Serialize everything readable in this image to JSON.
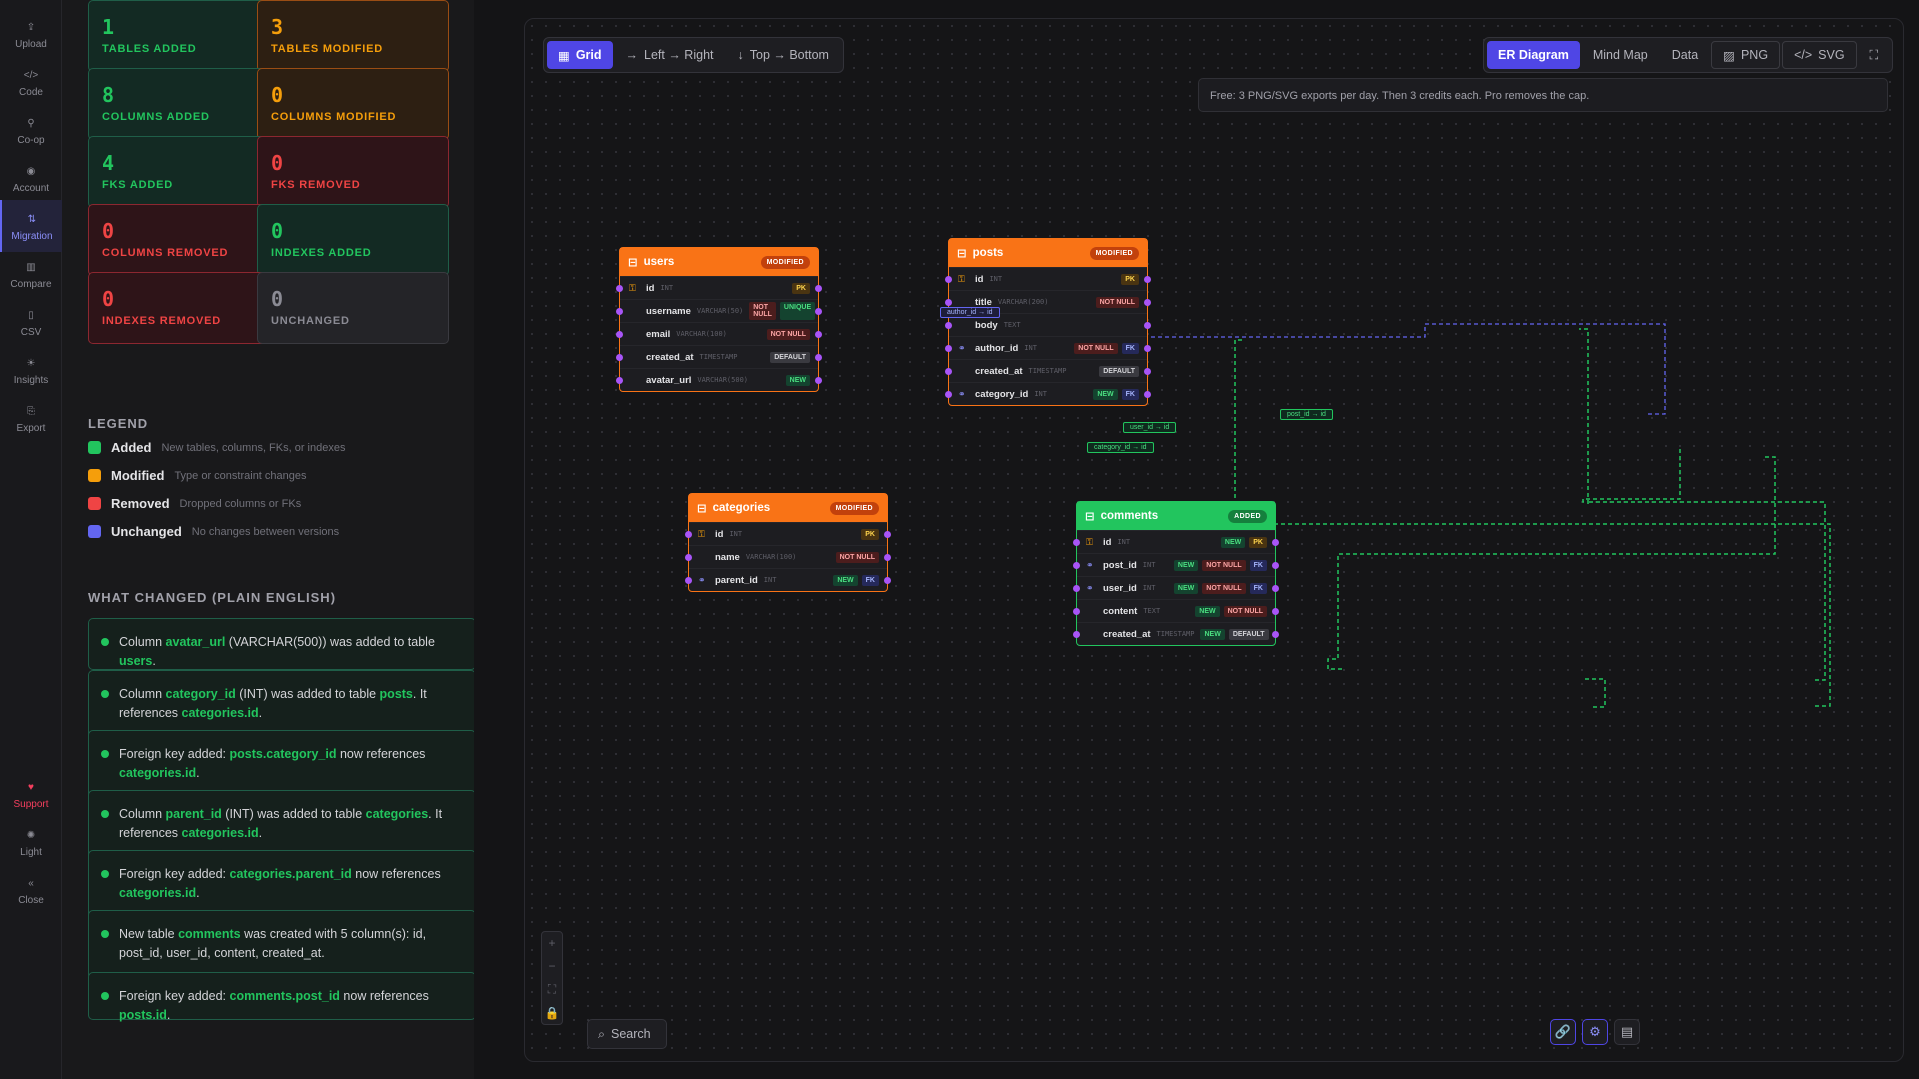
{
  "nav": [
    {
      "label": "Upload",
      "icon": "upload-icon"
    },
    {
      "label": "Code",
      "icon": "code-icon"
    },
    {
      "label": "Co-op",
      "icon": "link-icon"
    },
    {
      "label": "Account",
      "icon": "account-icon"
    },
    {
      "label": "Migration",
      "icon": "migration-icon"
    },
    {
      "label": "Compare",
      "icon": "chart-icon"
    },
    {
      "label": "CSV",
      "icon": "file-icon"
    },
    {
      "label": "Insights",
      "icon": "bulb-icon"
    },
    {
      "label": "Export",
      "icon": "export-icon"
    },
    {
      "label": "Support",
      "icon": "heart-icon"
    },
    {
      "label": "Light",
      "icon": "sun-icon"
    },
    {
      "label": "Close",
      "icon": "close-icon"
    }
  ],
  "stats": [
    {
      "value": "1",
      "label": "TABLES ADDED",
      "tone": "green"
    },
    {
      "value": "3",
      "label": "TABLES MODIFIED",
      "tone": "orange"
    },
    {
      "value": "8",
      "label": "COLUMNS ADDED",
      "tone": "green"
    },
    {
      "value": "0",
      "label": "COLUMNS MODIFIED",
      "tone": "orange"
    },
    {
      "value": "4",
      "label": "FKS ADDED",
      "tone": "green"
    },
    {
      "value": "0",
      "label": "FKS REMOVED",
      "tone": "red"
    },
    {
      "value": "0",
      "label": "COLUMNS REMOVED",
      "tone": "red"
    },
    {
      "value": "0",
      "label": "INDEXES ADDED",
      "tone": "green"
    },
    {
      "value": "0",
      "label": "INDEXES REMOVED",
      "tone": "red"
    },
    {
      "value": "0",
      "label": "UNCHANGED",
      "tone": "gray"
    }
  ],
  "legend": {
    "title": "LEGEND",
    "items": [
      {
        "name": "Added",
        "desc": "New tables, columns, FKs, or indexes",
        "color": "#22c55e"
      },
      {
        "name": "Modified",
        "desc": "Type or constraint changes",
        "color": "#f59e0b"
      },
      {
        "name": "Removed",
        "desc": "Dropped columns or FKs",
        "color": "#ef4444"
      },
      {
        "name": "Unchanged",
        "desc": "No changes between versions",
        "color": "#6366f1"
      }
    ]
  },
  "changes": {
    "title": "WHAT CHANGED (PLAIN ENGLISH)",
    "items": [
      {
        "a": "Column ",
        "b": "avatar_url",
        "c": " (VARCHAR(500)) was added to table ",
        "d": "users",
        "e": "."
      },
      {
        "a": "Column ",
        "b": "category_id",
        "c": " (INT) was added to table ",
        "d": "posts",
        "e": ". It references ",
        "f": "categories.id",
        "g": "."
      },
      {
        "a": "Foreign key added: ",
        "b": "posts.category_id",
        "c": " now references ",
        "d": "categories.id",
        "e": "."
      },
      {
        "a": "Column ",
        "b": "parent_id",
        "c": " (INT) was added to table ",
        "d": "categories",
        "e": ". It references ",
        "f": "categories.id",
        "g": "."
      },
      {
        "a": "Foreign key added: ",
        "b": "categories.parent_id",
        "c": " now references ",
        "d": "categories.id",
        "e": "."
      },
      {
        "a": "New table ",
        "b": "comments",
        "c": " was created with 5 column(s): id, post_id, user_id, content, created_at.",
        "d": "",
        "e": ""
      },
      {
        "a": "Foreign key added: ",
        "b": "comments.post_id",
        "c": " now references ",
        "d": "posts.id",
        "e": "."
      }
    ]
  },
  "toolbar": {
    "layout": [
      {
        "label": "Grid",
        "icon": "grid-icon"
      },
      {
        "label": "Left → Right",
        "icon": "arrow-right-icon"
      },
      {
        "label": "Top → Bottom",
        "icon": "arrow-down-icon"
      }
    ],
    "views": [
      "ER Diagram",
      "Mind Map",
      "Data"
    ],
    "exports": [
      {
        "label": "PNG",
        "icon": "image-icon"
      },
      {
        "label": "SVG",
        "icon": "code-icon"
      }
    ]
  },
  "notice": "Free: 3 PNG/SVG exports per day. Then 3 credits each. Pro removes the cap.",
  "search_label": "Search",
  "tables": {
    "users": {
      "name": "users",
      "badge": "MODIFIED",
      "rows": [
        {
          "icon": "key",
          "name": "id",
          "type": "INT",
          "tags": [
            [
              "PK",
              "pk"
            ]
          ]
        },
        {
          "icon": "",
          "name": "username",
          "type": "VARCHAR(50)",
          "tags": [
            [
              "NOT NULL",
              "nn"
            ],
            [
              "UNIQUE",
              "uq"
            ]
          ]
        },
        {
          "icon": "",
          "name": "email",
          "type": "VARCHAR(100)",
          "tags": [
            [
              "NOT NULL",
              "nn"
            ]
          ]
        },
        {
          "icon": "",
          "name": "created_at",
          "type": "TIMESTAMP",
          "tags": [
            [
              "DEFAULT",
              "def"
            ]
          ]
        },
        {
          "icon": "",
          "name": "avatar_url",
          "type": "VARCHAR(500)",
          "tags": [
            [
              "NEW",
              "new"
            ]
          ]
        }
      ]
    },
    "posts": {
      "name": "posts",
      "badge": "MODIFIED",
      "rows": [
        {
          "icon": "key",
          "name": "id",
          "type": "INT",
          "tags": [
            [
              "PK",
              "pk"
            ]
          ]
        },
        {
          "icon": "",
          "name": "title",
          "type": "VARCHAR(200)",
          "tags": [
            [
              "NOT NULL",
              "nn"
            ]
          ]
        },
        {
          "icon": "",
          "name": "body",
          "type": "TEXT",
          "tags": []
        },
        {
          "icon": "link",
          "name": "author_id",
          "type": "INT",
          "tags": [
            [
              "NOT NULL",
              "nn"
            ],
            [
              "FK",
              "fk"
            ]
          ]
        },
        {
          "icon": "",
          "name": "created_at",
          "type": "TIMESTAMP",
          "tags": [
            [
              "DEFAULT",
              "def"
            ]
          ]
        },
        {
          "icon": "link",
          "name": "category_id",
          "type": "INT",
          "tags": [
            [
              "NEW",
              "new"
            ],
            [
              "FK",
              "fk"
            ]
          ]
        }
      ]
    },
    "categories": {
      "name": "categories",
      "badge": "MODIFIED",
      "rows": [
        {
          "icon": "key",
          "name": "id",
          "type": "INT",
          "tags": [
            [
              "PK",
              "pk"
            ]
          ]
        },
        {
          "icon": "",
          "name": "name",
          "type": "VARCHAR(100)",
          "tags": [
            [
              "NOT NULL",
              "nn"
            ]
          ]
        },
        {
          "icon": "link",
          "name": "parent_id",
          "type": "INT",
          "tags": [
            [
              "NEW",
              "new"
            ],
            [
              "FK",
              "fk"
            ]
          ]
        }
      ]
    },
    "comments": {
      "name": "comments",
      "badge": "ADDED",
      "rows": [
        {
          "icon": "key",
          "name": "id",
          "type": "INT",
          "tags": [
            [
              "NEW",
              "new"
            ],
            [
              "PK",
              "pk"
            ]
          ]
        },
        {
          "icon": "link",
          "name": "post_id",
          "type": "INT",
          "tags": [
            [
              "NEW",
              "new"
            ],
            [
              "NOT NULL",
              "nn"
            ],
            [
              "FK",
              "fk"
            ]
          ]
        },
        {
          "icon": "link",
          "name": "user_id",
          "type": "INT",
          "tags": [
            [
              "NEW",
              "new"
            ],
            [
              "NOT NULL",
              "nn"
            ],
            [
              "FK",
              "fk"
            ]
          ]
        },
        {
          "icon": "",
          "name": "content",
          "type": "TEXT",
          "tags": [
            [
              "NEW",
              "new"
            ],
            [
              "NOT NULL",
              "nn"
            ]
          ]
        },
        {
          "icon": "",
          "name": "created_at",
          "type": "TIMESTAMP",
          "tags": [
            [
              "NEW",
              "new"
            ],
            [
              "DEFAULT",
              "def"
            ]
          ]
        }
      ]
    }
  },
  "edge_labels": [
    "author_id → id",
    "post_id → id",
    "user_id → id",
    "category_id → id"
  ],
  "colors": {
    "accent": "#4f46e5",
    "added": "#22c55e",
    "modified": "#f97316",
    "removed": "#ef4444",
    "unchanged": "#6366f1"
  }
}
